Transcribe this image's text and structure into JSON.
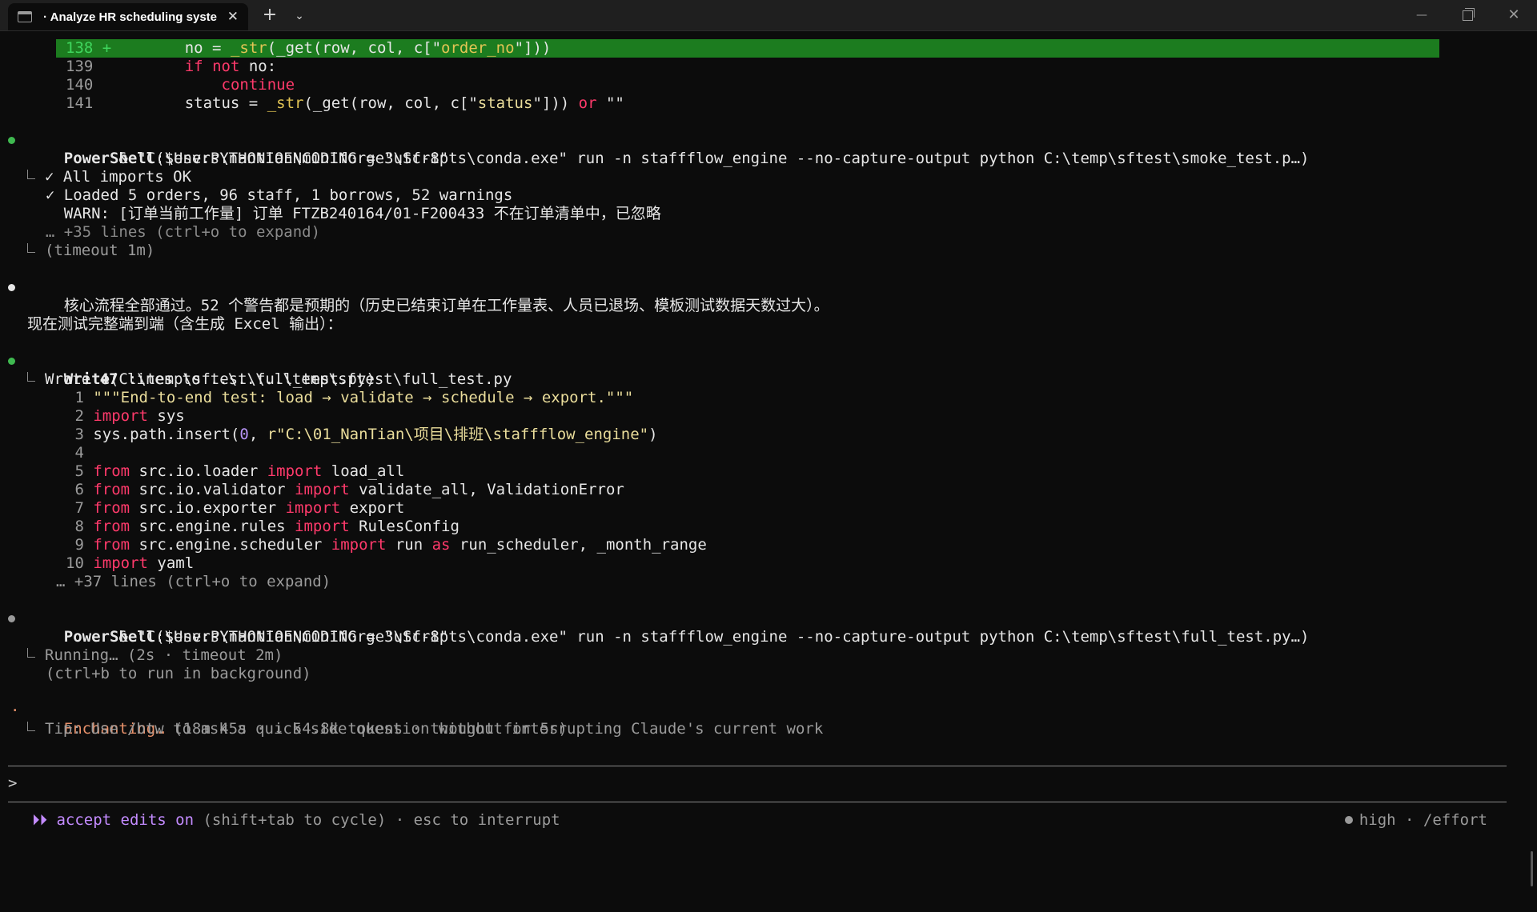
{
  "window": {
    "tab_title": "· Analyze HR scheduling syste",
    "tab_close_glyph": "✕",
    "new_tab_glyph": "+",
    "tab_dropdown_glyph": "⌄",
    "minimize_glyph": "—",
    "close_glyph": "✕"
  },
  "diff": {
    "rows": [
      {
        "num": "138",
        "mark": "+",
        "indent": "        ",
        "tokens": [
          [
            "no = ",
            "w"
          ],
          [
            "_str",
            "fn"
          ],
          [
            "(_get(row, col, c[\"",
            "w"
          ],
          [
            "order_no",
            "fn"
          ],
          [
            "\"]))",
            "w"
          ]
        ]
      },
      {
        "num": "139",
        "mark": " ",
        "indent": "        ",
        "tokens": [
          [
            "if ",
            "kw"
          ],
          [
            "not ",
            "kw"
          ],
          [
            "no:",
            "w"
          ]
        ]
      },
      {
        "num": "140",
        "mark": " ",
        "indent": "            ",
        "tokens": [
          [
            "continue",
            "kw"
          ]
        ]
      },
      {
        "num": "141",
        "mark": " ",
        "indent": "        ",
        "tokens": [
          [
            "status = ",
            "w"
          ],
          [
            "_str",
            "fn"
          ],
          [
            "(_get(row, col, c[\"",
            "w"
          ],
          [
            "status",
            "str"
          ],
          [
            "\"])) ",
            "w"
          ],
          [
            "or",
            "kw"
          ],
          [
            " \"\"",
            "w"
          ]
        ]
      }
    ]
  },
  "ps1": {
    "tool": "PowerShell",
    "arg": "($env:PYTHONIOENCODING = \"utf-8\"",
    "cmd": "          & \"C:\\Users\\nantian\\miniforge3\\Scripts\\conda.exe\" run -n staffflow_engine --no-capture-output python C:\\temp\\sftest\\smoke_test.p…)",
    "out1": "✓ All imports OK",
    "out2": "  ✓ Loaded 5 orders, 96 staff, 1 borrows, 52 warnings",
    "out3": "    WARN: [订单当前工作量] 订单 FTZB240164/01-F200433 不在订单清单中，已忽略",
    "out4": "  … +35 lines (ctrl+o to expand)",
    "out5": "(timeout 1m)"
  },
  "msg": {
    "line1": "核心流程全部通过。52 个警告都是预期的（历史已结束订单在工作量表、人员已退场、模板测试数据天数过大）。",
    "line2": "现在测试完整端到端（含生成 Excel 输出）："
  },
  "write": {
    "tool": "Write",
    "arg": "(C:\\temp\\sftest\\full_test.py)",
    "result_prefix": "Wrote ",
    "result_count": "47",
    "result_suffix": " lines to ..\\..\\..\\temp\\sftest\\full_test.py",
    "code": [
      {
        "num": " 1",
        "tokens": [
          [
            "\"\"\"End-to-end test: load → validate → schedule → export.\"\"\"",
            "str"
          ]
        ]
      },
      {
        "num": " 2",
        "tokens": [
          [
            "import ",
            "kw"
          ],
          [
            "sys",
            "w"
          ]
        ]
      },
      {
        "num": " 3",
        "tokens": [
          [
            "sys.path.insert(",
            "w"
          ],
          [
            "0",
            "num"
          ],
          [
            ", ",
            "w"
          ],
          [
            "r\"C:\\01_NanTian\\项目\\排班\\staffflow_engine\"",
            "str"
          ],
          [
            ")",
            "w"
          ]
        ]
      },
      {
        "num": " 4",
        "tokens": []
      },
      {
        "num": " 5",
        "tokens": [
          [
            "from ",
            "kw"
          ],
          [
            "src.io.loader ",
            "w"
          ],
          [
            "import ",
            "kw"
          ],
          [
            "load_all",
            "w"
          ]
        ]
      },
      {
        "num": " 6",
        "tokens": [
          [
            "from ",
            "kw"
          ],
          [
            "src.io.validator ",
            "w"
          ],
          [
            "import ",
            "kw"
          ],
          [
            "validate_all, ValidationError",
            "w"
          ]
        ]
      },
      {
        "num": " 7",
        "tokens": [
          [
            "from ",
            "kw"
          ],
          [
            "src.io.exporter ",
            "w"
          ],
          [
            "import ",
            "kw"
          ],
          [
            "export",
            "w"
          ]
        ]
      },
      {
        "num": " 8",
        "tokens": [
          [
            "from ",
            "kw"
          ],
          [
            "src.engine.rules ",
            "w"
          ],
          [
            "import ",
            "kw"
          ],
          [
            "RulesConfig",
            "w"
          ]
        ]
      },
      {
        "num": " 9",
        "tokens": [
          [
            "from ",
            "kw"
          ],
          [
            "src.engine.scheduler ",
            "w"
          ],
          [
            "import ",
            "kw"
          ],
          [
            "run ",
            "w"
          ],
          [
            "as ",
            "kw"
          ],
          [
            "run_scheduler, _month_range",
            "w"
          ]
        ]
      },
      {
        "num": "10",
        "tokens": [
          [
            "import ",
            "kw"
          ],
          [
            "yaml",
            "w"
          ]
        ]
      }
    ],
    "more": "… +37 lines (ctrl+o to expand)"
  },
  "ps2": {
    "tool": "PowerShell",
    "arg": "($env:PYTHONIOENCODING = \"utf-8\"",
    "cmd": "          & \"C:\\Users\\nantian\\miniforge3\\Scripts\\conda.exe\" run -n staffflow_engine --no-capture-output python C:\\temp\\sftest\\full_test.py…)",
    "running": "Running… (2s · timeout 2m)",
    "hint": "  (ctrl+b to run in background)"
  },
  "spinner": {
    "glyph": "·",
    "word": "Enchanting…",
    "detail": " (18m 45s · ↓ 54.8k tokens · thought for 5s)",
    "tip": "Tip: Use /btw to ask a quick side question without interrupting Claude's current work"
  },
  "prompt": {
    "symbol": ">"
  },
  "status": {
    "arrows": "⏵⏵",
    "mode": " accept edits on",
    "rest": " (shift+tab to cycle) · esc to interrupt",
    "effort": "high · /effort"
  },
  "colors": {
    "background": "#0c0c0c",
    "diff_added": "#1c7c1f",
    "keyword": "#ff3a6b",
    "string": "#eadd9b",
    "success_bullet": "#3fb950",
    "spinner": "#e8916a",
    "mode": "#c38bff"
  }
}
